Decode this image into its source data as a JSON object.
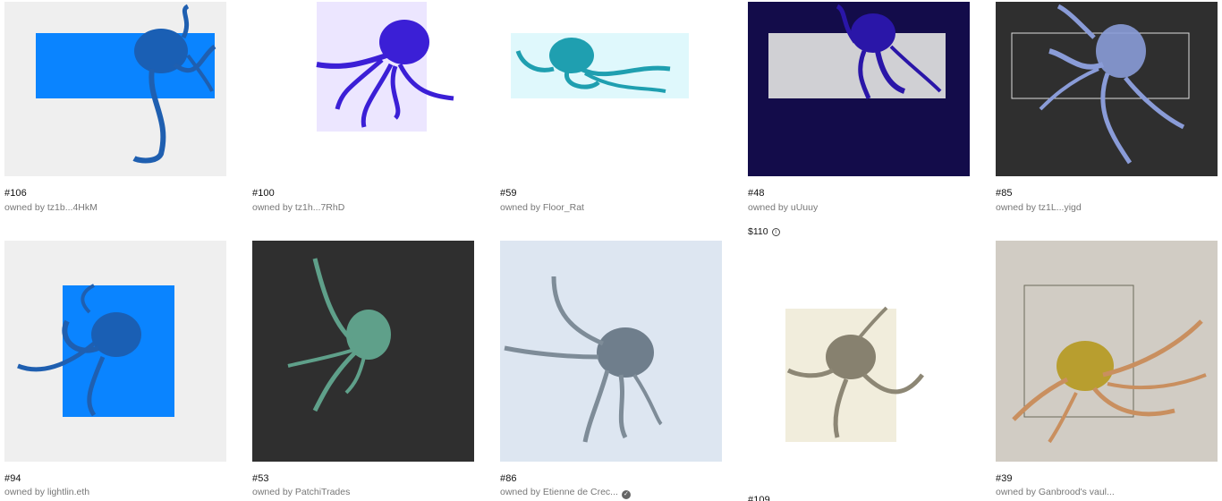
{
  "gallery": {
    "items": [
      {
        "id": "106",
        "title": "#106",
        "owner": "owned by tz1b...4HkM"
      },
      {
        "id": "100",
        "title": "#100",
        "owner": "owned by tz1h...7RhD"
      },
      {
        "id": "59",
        "title": "#59",
        "owner": "owned by Floor_Rat"
      },
      {
        "id": "48",
        "title": "#48",
        "owner": "owned by uUuuy",
        "price": "$110"
      },
      {
        "id": "85",
        "title": "#85",
        "owner": "owned by tz1L...yigd"
      },
      {
        "id": "94",
        "title": "#94",
        "owner": "owned by lightlin.eth"
      },
      {
        "id": "53",
        "title": "#53",
        "owner": "owned by PatchiTrades"
      },
      {
        "id": "86",
        "title": "#86",
        "owner": "owned by Etienne de Crec...",
        "verified": true
      },
      {
        "id": "109",
        "title": "#109"
      },
      {
        "id": "39",
        "title": "#39",
        "owner": "owned by Ganbrood's vaul..."
      }
    ]
  },
  "colors": {
    "blue_bright": "#0a84ff",
    "indigo": "#3b1fd6",
    "teal": "#1f9fb0",
    "navy_bg": "#130c4a",
    "dark_bg": "#2f2f2f",
    "lavender": "#ece6ff",
    "light_cyan": "#dff8fc",
    "pale_blue_bg": "#dde6f1",
    "cream": "#f1eddc",
    "taupe_bg": "#d1ccc4",
    "gold": "#b89e2f"
  },
  "icons": {
    "info": "info-icon",
    "verified": "verified-check-icon"
  }
}
